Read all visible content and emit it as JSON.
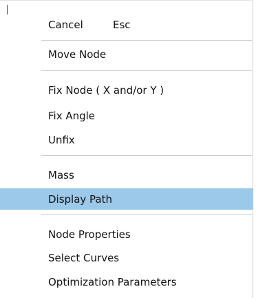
{
  "context_menu": {
    "items": [
      {
        "label": "Cancel",
        "shortcut": "Esc"
      },
      {
        "label": "Move Node"
      },
      {
        "label": "Fix Node ( X and/or Y )"
      },
      {
        "label": "Fix Angle"
      },
      {
        "label": "Unfix"
      },
      {
        "label": "Mass"
      },
      {
        "label": "Display Path",
        "highlighted": true
      },
      {
        "label": "Node Properties"
      },
      {
        "label": "Select Curves"
      },
      {
        "label": "Optimization Parameters"
      }
    ],
    "highlight_color": "#9cc8ea"
  }
}
